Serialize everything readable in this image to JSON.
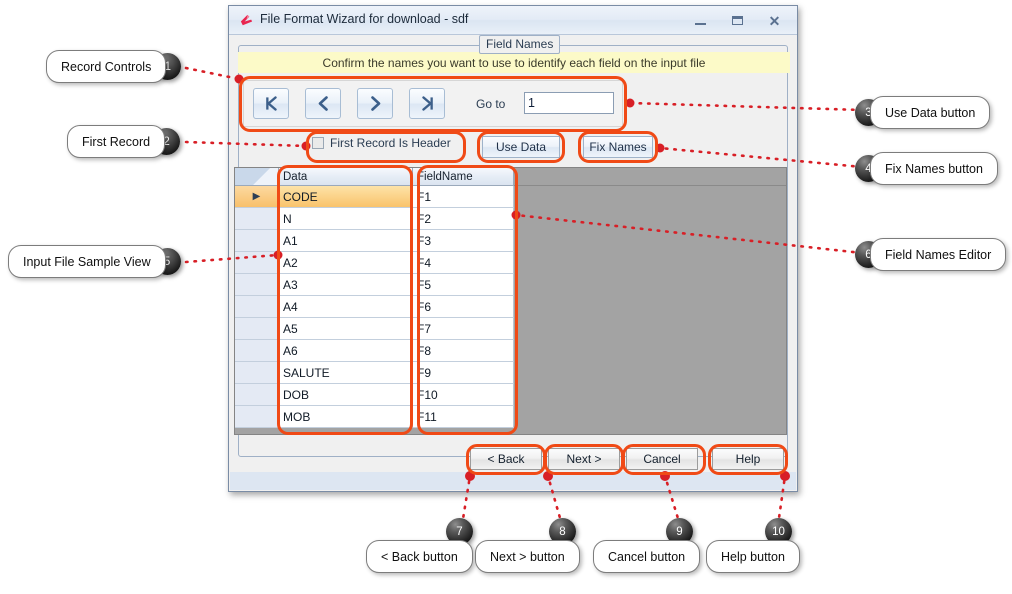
{
  "window": {
    "title": "File Format Wizard for download - sdf",
    "icon": "app-icon",
    "minimize_label": "–",
    "maximize_label": "□",
    "close_label": "×"
  },
  "group": {
    "label": "Field Names",
    "banner": "Confirm the names you want to use to identify each field on the input file"
  },
  "record_controls": {
    "first_label": "first-record-icon",
    "prev_label": "previous-record-icon",
    "next_label": "next-record-icon",
    "last_label": "last-record-icon",
    "goto_label": "Go to",
    "goto_value": "1",
    "goto_placeholder": ""
  },
  "options": {
    "first_record_is_header": "First Record Is Header",
    "first_record_is_header_checked": false,
    "use_data": "Use Data",
    "fix_names": "Fix Names"
  },
  "grid": {
    "columns": [
      "Data",
      "FieldName"
    ],
    "selected_row_index": 0,
    "row_indicator": "▶",
    "rows": [
      {
        "data": "CODE",
        "field": "F1"
      },
      {
        "data": "N",
        "field": "F2"
      },
      {
        "data": "A1",
        "field": "F3"
      },
      {
        "data": "A2",
        "field": "F4"
      },
      {
        "data": "A3",
        "field": "F5"
      },
      {
        "data": "A4",
        "field": "F6"
      },
      {
        "data": "A5",
        "field": "F7"
      },
      {
        "data": "A6",
        "field": "F8"
      },
      {
        "data": "SALUTE",
        "field": "F9"
      },
      {
        "data": "DOB",
        "field": "F10"
      },
      {
        "data": "MOB",
        "field": "F11"
      }
    ]
  },
  "dialog_buttons": {
    "back": "< Back",
    "next": "Next >",
    "cancel": "Cancel",
    "help": "Help"
  },
  "callouts": [
    {
      "num": "1",
      "label": "Record Controls"
    },
    {
      "num": "2",
      "label": "First Record"
    },
    {
      "num": "3",
      "label": "Use Data button"
    },
    {
      "num": "4",
      "label": "Fix Names button"
    },
    {
      "num": "5",
      "label": "Input File Sample View"
    },
    {
      "num": "6",
      "label": "Field Names Editor"
    },
    {
      "num": "7",
      "label": "< Back button"
    },
    {
      "num": "8",
      "label": "Next > button"
    },
    {
      "num": "9",
      "label": "Cancel button"
    },
    {
      "num": "10",
      "label": "Help button"
    }
  ],
  "colors": {
    "highlight": "#f04a16",
    "connector": "#d81f26",
    "banner_bg": "#fcfac8",
    "grid_bg": "#a3a3a3",
    "selected_row": "#f9c36b"
  }
}
